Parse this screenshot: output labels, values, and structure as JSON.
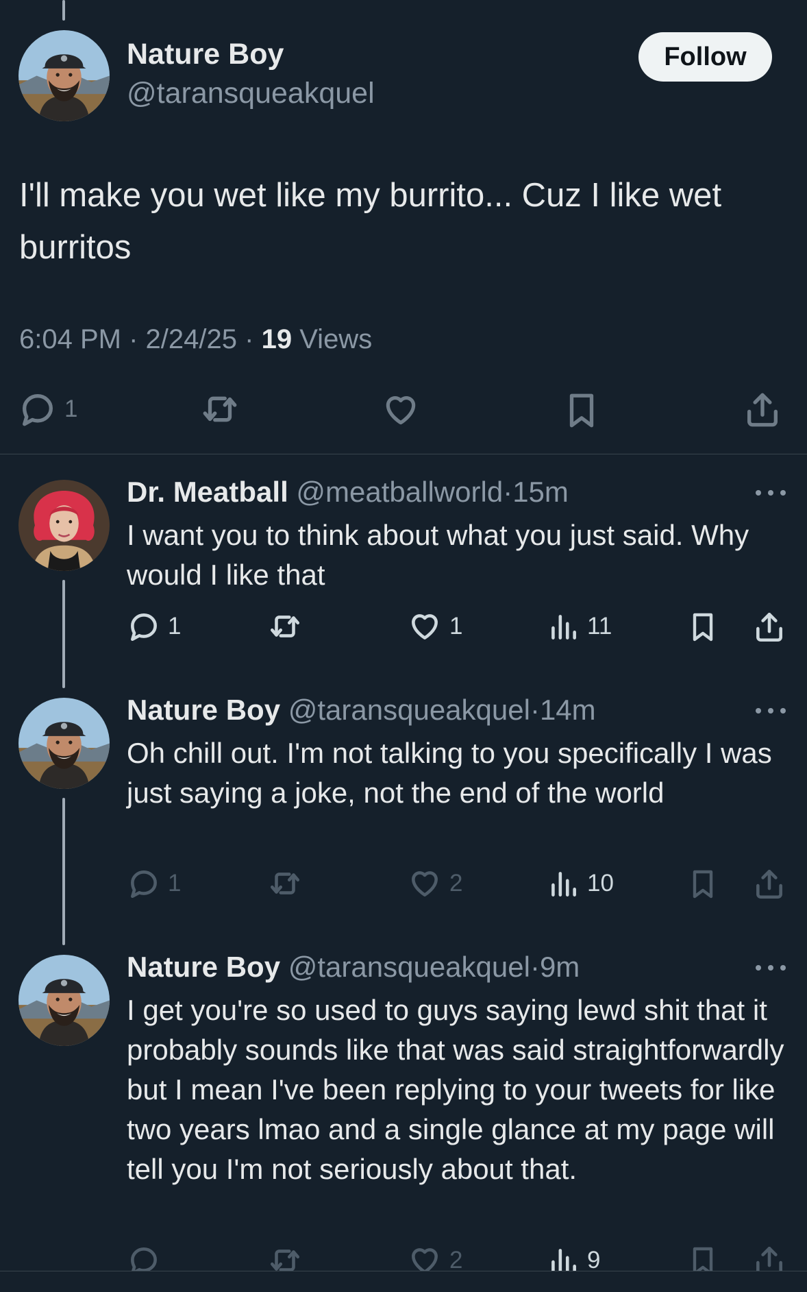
{
  "main_tweet": {
    "name": "Nature Boy",
    "handle": "@taransqueakquel",
    "follow_label": "Follow",
    "text": "I'll make you wet like my burrito... Cuz I like wet burritos",
    "time": "6:04 PM",
    "date": "2/24/25",
    "views_count": "19",
    "views_label": "Views",
    "reply_count": "1"
  },
  "replies": [
    {
      "name": "Dr. Meatball",
      "handle": "@meatballworld",
      "age": "15m",
      "text": "I want you to think about what you just said. Why would I like that",
      "reply_count": "1",
      "like_count": "1",
      "view_count": "11"
    },
    {
      "name": "Nature Boy",
      "handle": "@taransqueakquel",
      "age": "14m",
      "text": "Oh chill out. I'm not talking to you specifically I was just saying a joke, not the end of the world",
      "reply_count": "1",
      "like_count": "2",
      "view_count": "10"
    },
    {
      "name": "Nature Boy",
      "handle": "@taransqueakquel",
      "age": "9m",
      "text": "I get you're so used to guys saying lewd shit that it probably sounds like that was said straightforwardly but I mean I've been replying to your tweets for like two years lmao and a single glance at my page will tell you I'm not seriously about that.",
      "like_count": "2",
      "view_count": "9"
    }
  ],
  "separator": "·",
  "colors": {
    "background": "#15202b",
    "text_primary": "#e7e9ea",
    "text_secondary": "#8b98a5",
    "divider": "#38444d",
    "follow_bg": "#eff3f4"
  },
  "icons": [
    "reply-icon",
    "retweet-icon",
    "like-icon",
    "views-icon",
    "bookmark-icon",
    "share-icon",
    "more-icon"
  ]
}
